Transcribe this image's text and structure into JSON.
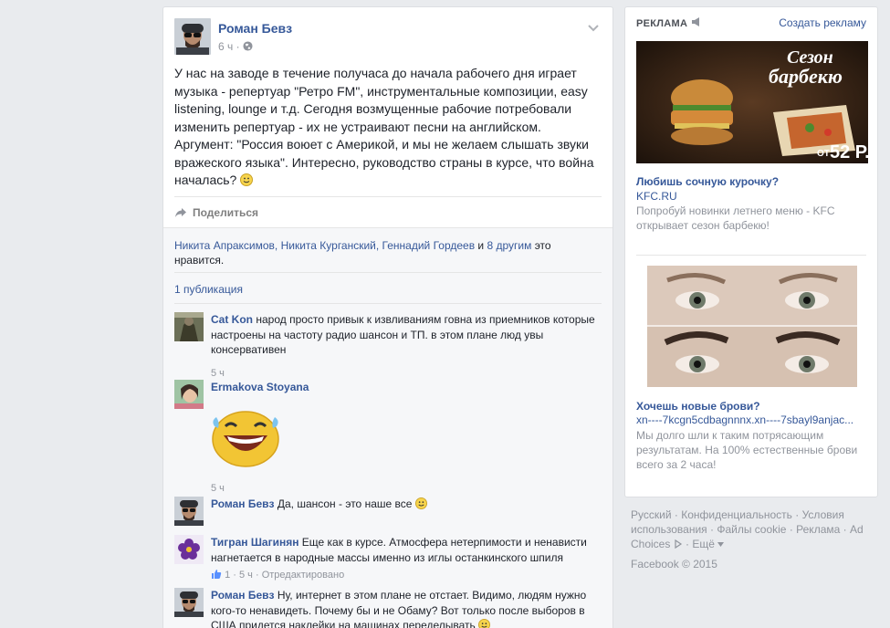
{
  "post": {
    "author": "Роман Бевз",
    "time": "6 ч",
    "text": "У нас на заводе в течение получаса до начала рабочего дня играет музыка - репертуар \"Ретро FM\", инструментальные композиции, easy listening, lounge и т.д. Сегодня возмущенные рабочие потребовали изменить репертуар - их не устраивают песни на английском. Аргумент: \"Россия воюет с Америкой, и мы не желаем слышать звуки вражеского языка\". Интересно, руководство страны в курсе, что война началась?",
    "share_label": "Поделиться",
    "likes": {
      "names": "Никита Апраксимов, Никита Курганский, Геннадий Гордеев",
      "and": " и ",
      "others": "8 другим",
      "suffix": " это нравится."
    },
    "publications": "1 публикация"
  },
  "comments": [
    {
      "name": "Cat Kon",
      "text": "народ просто привык к извливаниям говна из приемников которые настроены на частоту радио шансон и ТП. в этом плане люд увы консервативен",
      "time": "5 ч"
    },
    {
      "name": "Ermakova Stoyana",
      "text": "",
      "time": "5 ч"
    },
    {
      "name": "Роман Бевз",
      "text": "Да, шансон - это наше все",
      "time": ""
    },
    {
      "name": "Тигран Шагинян",
      "text": "Еще как в курсе. Атмосфера нетерпимости и ненависти нагнетается в народные массы именно из иглы останкинского шпиля",
      "likes": "1",
      "time": "5 ч",
      "edited": "Отредактировано"
    },
    {
      "name": "Роман Бевз",
      "text": "Ну, интернет в этом плане не отстает. Видимо, людям нужно кого-то ненавидеть. Почему бы и не Обаму? Вот только после выборов в США придется наклейки на машинах переделывать",
      "time": ""
    }
  ],
  "ads": {
    "title": "РЕКЛАМА",
    "create": "Создать рекламу",
    "items": [
      {
        "image_text1": "Сезон",
        "image_text2": "барбекю",
        "price_prefix": "ОТ",
        "price": "52 Р.",
        "headline": "Любишь сочную курочку?",
        "url": "KFC.RU",
        "desc": "Попробуй новинки летнего меню - KFC открывает сезон барбекю!"
      },
      {
        "headline": "Хочешь новые брови?",
        "url": "xn----7kcgn5cdbagnnnx.xn----7sbayl9anjac...",
        "desc": "Мы долго шли к таким потрясающим результатам. На 100% естественные брови всего за 2 часа!"
      }
    ]
  },
  "footer": {
    "links": [
      "Русский",
      "Конфиденциальность",
      "Условия использования",
      "Файлы cookie",
      "Реклама",
      "Ad Choices",
      "Ещё"
    ],
    "copyright": "Facebook © 2015"
  }
}
